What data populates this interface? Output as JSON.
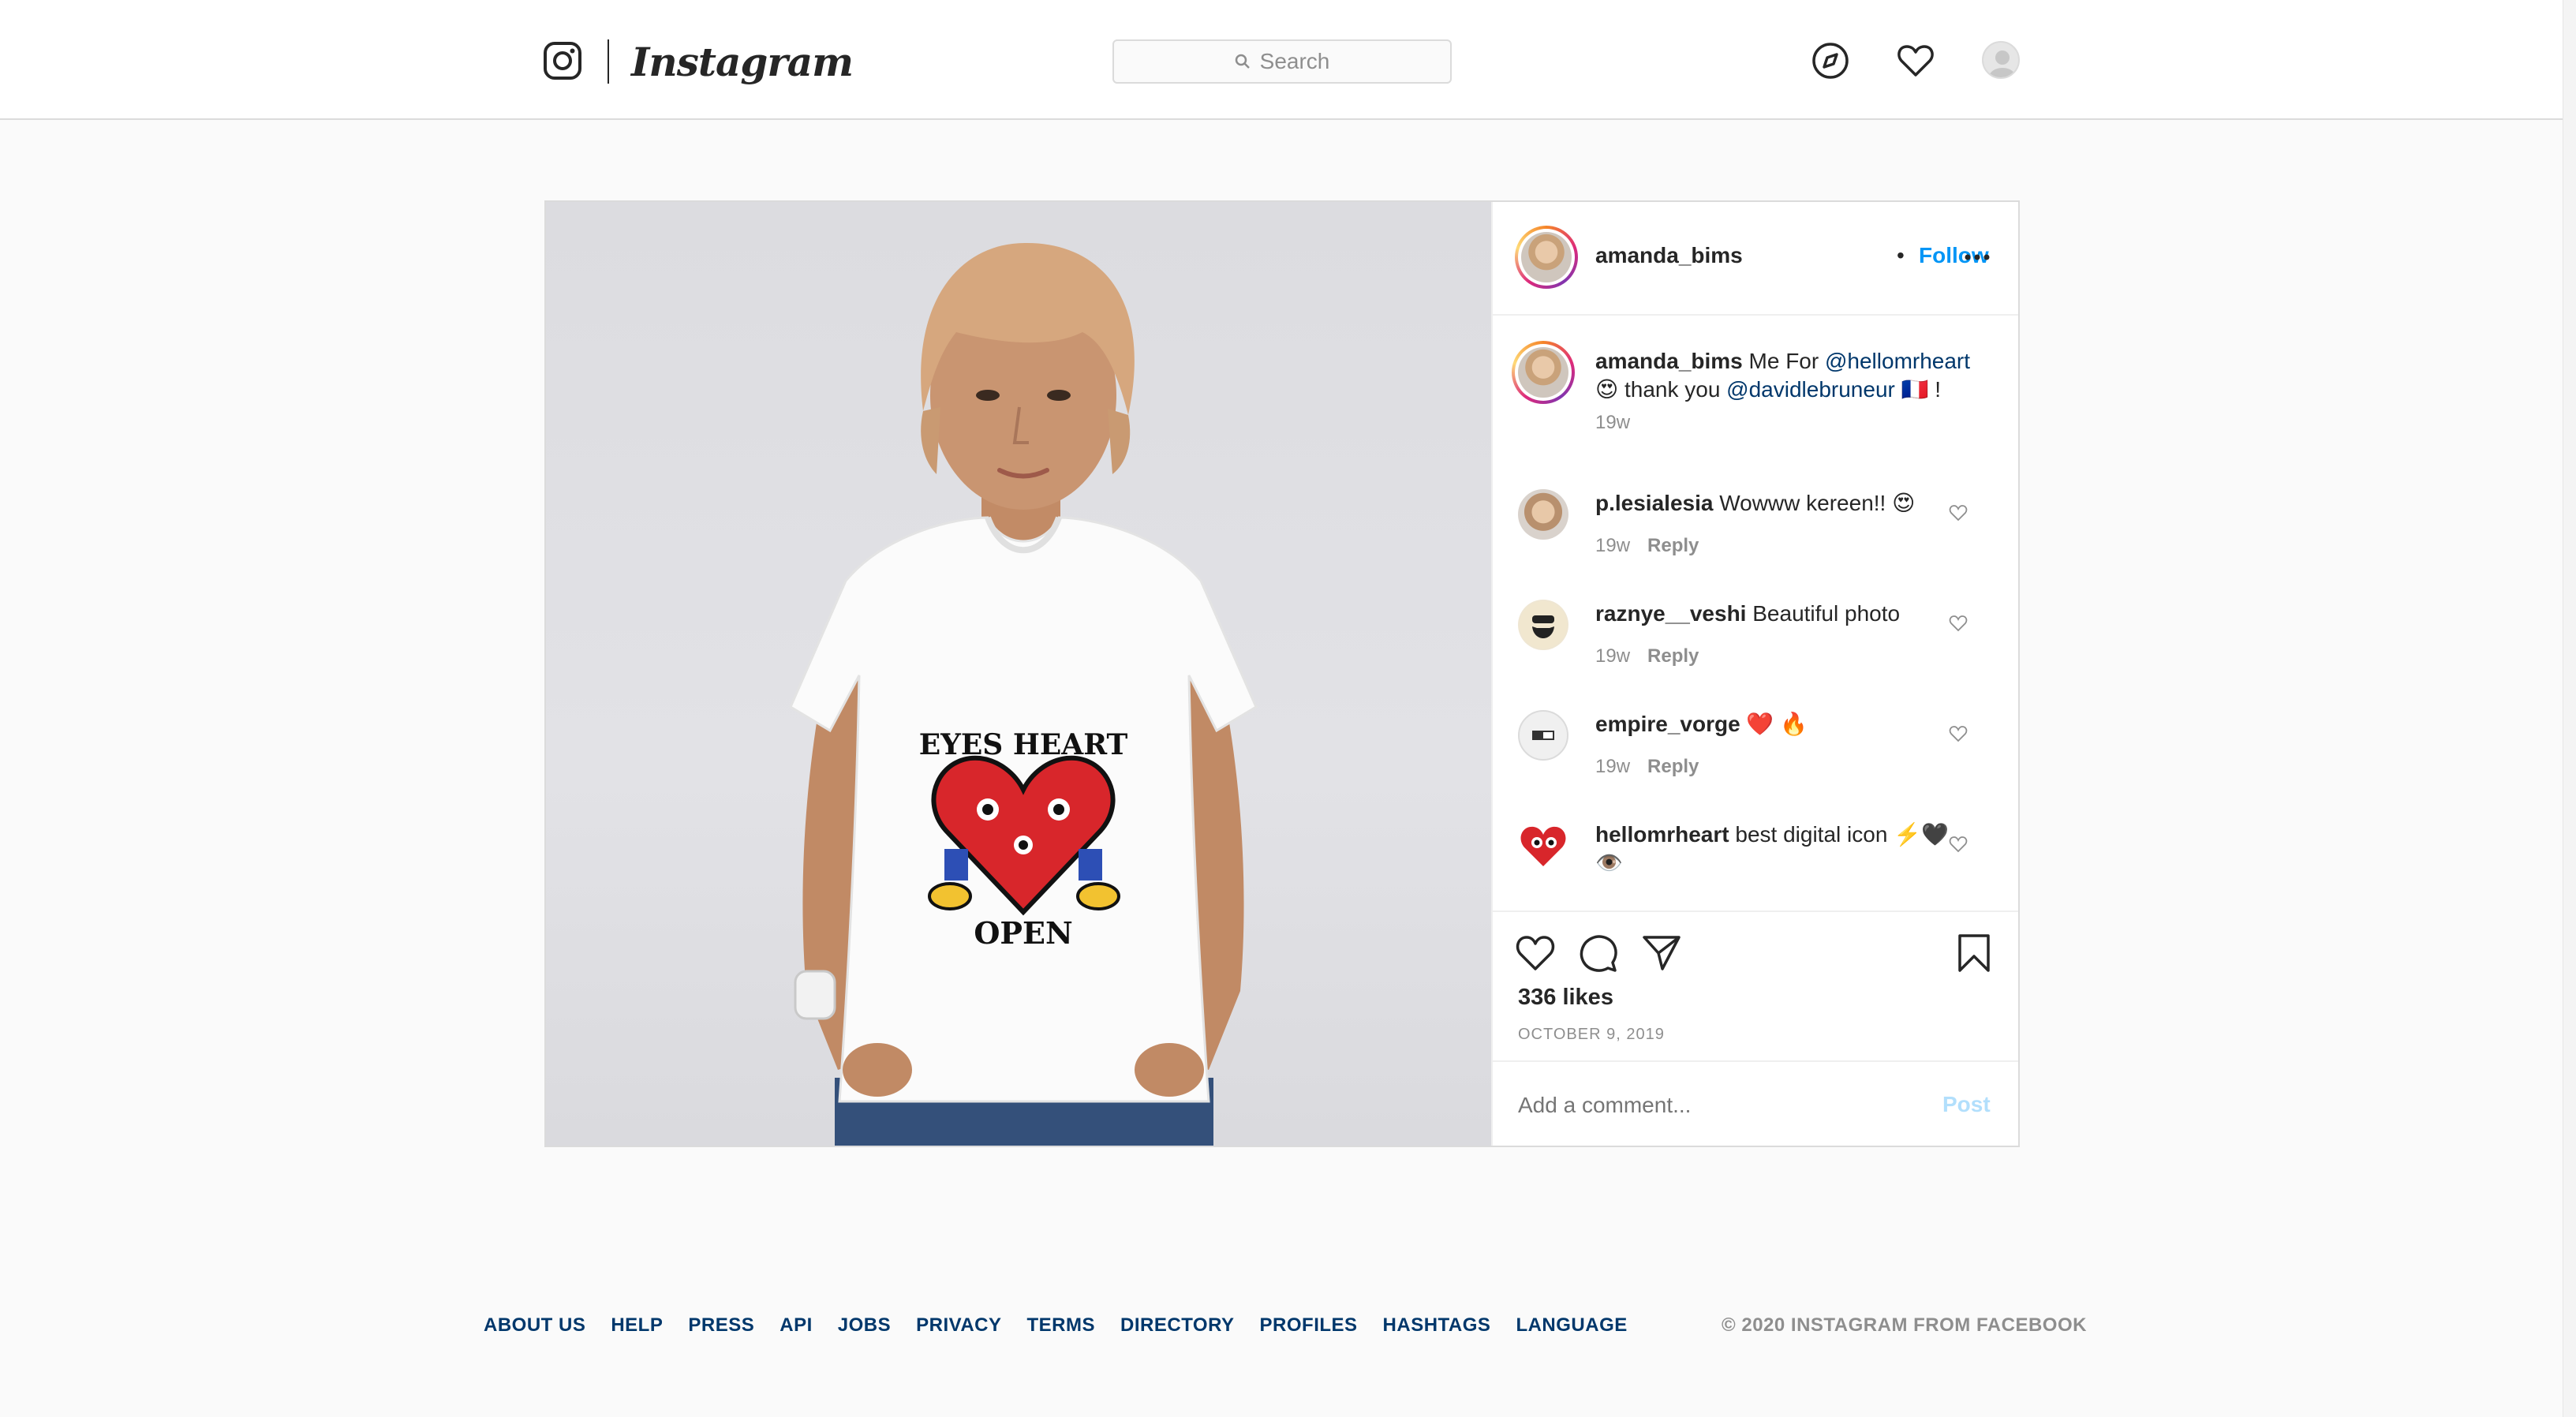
{
  "header": {
    "logo_text": "Instagram",
    "search_placeholder": "Search",
    "icons": [
      "instagram-glyph-icon",
      "explore-compass-icon",
      "activity-heart-icon",
      "profile-avatar"
    ]
  },
  "post": {
    "author": "amanda_bims",
    "follow_label": "Follow",
    "separator": "•",
    "caption": {
      "username": "amanda_bims",
      "text_before_mention": " Me For ",
      "mention_1": "@hellomrheart",
      "line2_prefix": "😍 thank you ",
      "mention_2": "@davidlebruneur",
      "line2_suffix": " 🇫🇷 !",
      "time": "19w"
    },
    "comments": [
      {
        "username": "p.lesialesia",
        "text": " Wowww kereen!! 😍",
        "time": "19w",
        "reply_label": "Reply"
      },
      {
        "username": "raznye__veshi",
        "text": " Beautiful photo",
        "time": "19w",
        "reply_label": "Reply"
      },
      {
        "username": "empire_vorge",
        "text": " ❤️ 🔥",
        "time": "19w",
        "reply_label": "Reply"
      },
      {
        "username": "hellomrheart",
        "text": " best digital icon ⚡️🖤👁️",
        "time": "",
        "reply_label": ""
      }
    ],
    "likes": "336 likes",
    "date": "OCTOBER 9, 2019",
    "comment_placeholder": "Add a comment...",
    "post_button": "Post",
    "shirt_text": {
      "top": "EYES HEART",
      "bottom": "OPEN"
    }
  },
  "footer": {
    "links": [
      "ABOUT US",
      "HELP",
      "PRESS",
      "API",
      "JOBS",
      "PRIVACY",
      "TERMS",
      "DIRECTORY",
      "PROFILES",
      "HASHTAGS",
      "LANGUAGE"
    ],
    "copyright": "© 2020 INSTAGRAM FROM FACEBOOK"
  },
  "colors": {
    "link_blue": "#0095f6",
    "mention_blue": "#00376b",
    "muted": "#8e8e8e",
    "border": "#dbdbdb"
  }
}
